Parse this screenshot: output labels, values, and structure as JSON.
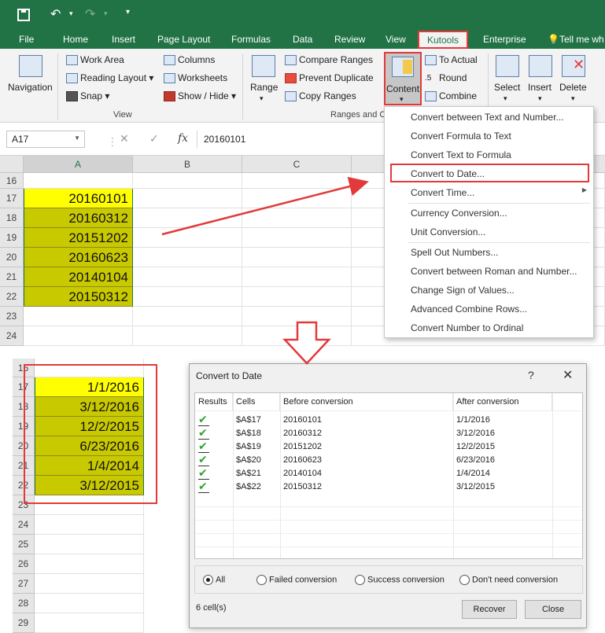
{
  "quick_access": {
    "save_icon": "save-icon",
    "undo_icon": "undo-icon",
    "redo_icon": "redo-icon"
  },
  "tabs": [
    "File",
    "Home",
    "Insert",
    "Page Layout",
    "Formulas",
    "Data",
    "Review",
    "View",
    "Kutools",
    "Enterprise",
    "Tell me wh"
  ],
  "ribbon": {
    "navigation": "Navigation",
    "view_group": {
      "work_area": "Work Area",
      "reading_layout": "Reading Layout",
      "snap": "Snap",
      "columns": "Columns",
      "worksheets": "Worksheets",
      "show_hide": "Show / Hide",
      "label": "View"
    },
    "range_group": {
      "range": "Range",
      "compare_ranges": "Compare Ranges",
      "prevent_duplicate": "Prevent Duplicate",
      "copy_ranges": "Copy Ranges",
      "label": "Ranges and C"
    },
    "content": "Content",
    "to_actual": "To Actual",
    "round": "Round",
    "combine": "Combine",
    "select": "Select",
    "insert": "Insert",
    "delete": "Delete"
  },
  "formula_bar": {
    "name_box": "A17",
    "formula": "20160101",
    "cancel": "✕",
    "enter": "✓",
    "fx": "fx"
  },
  "grid_top": {
    "columns": [
      "A",
      "B",
      "C"
    ],
    "rows": [
      "16",
      "17",
      "18",
      "19",
      "20",
      "21",
      "22",
      "23",
      "24"
    ],
    "values": [
      "20160101",
      "20160312",
      "20151202",
      "20160623",
      "20140104",
      "20150312"
    ]
  },
  "menu": {
    "items": [
      "Convert between Text and Number...",
      "Convert Formula to Text",
      "Convert Text to Formula",
      "Convert to Date...",
      "Convert Time...",
      "Currency Conversion...",
      "Unit Conversion...",
      "Spell Out Numbers...",
      "Convert between Roman and Number...",
      "Change Sign of Values...",
      "Advanced Combine Rows...",
      "Convert Number to Ordinal"
    ]
  },
  "grid_bottom": {
    "rows": [
      "16",
      "17",
      "18",
      "19",
      "20",
      "21",
      "22",
      "23",
      "24",
      "25",
      "26",
      "27",
      "28",
      "29"
    ],
    "values": [
      "1/1/2016",
      "3/12/2016",
      "12/2/2015",
      "6/23/2016",
      "1/4/2014",
      "3/12/2015"
    ]
  },
  "dialog": {
    "title": "Convert to Date",
    "help": "?",
    "close": "✕",
    "headers": [
      "Results",
      "Cells",
      "Before conversion",
      "After conversion"
    ],
    "rows": [
      {
        "cell": "$A$17",
        "before": "20160101",
        "after": "1/1/2016"
      },
      {
        "cell": "$A$18",
        "before": "20160312",
        "after": "3/12/2016"
      },
      {
        "cell": "$A$19",
        "before": "20151202",
        "after": "12/2/2015"
      },
      {
        "cell": "$A$20",
        "before": "20160623",
        "after": "6/23/2016"
      },
      {
        "cell": "$A$21",
        "before": "20140104",
        "after": "1/4/2014"
      },
      {
        "cell": "$A$22",
        "before": "20150312",
        "after": "3/12/2015"
      }
    ],
    "filters": [
      "All",
      "Failed conversion",
      "Success conversion",
      "Don't need conversion"
    ],
    "selected_filter": "All",
    "count": "6 cell(s)",
    "recover": "Recover",
    "close_btn": "Close"
  },
  "colors": {
    "excel_green": "#217346",
    "highlight_red": "#e23a3a",
    "cell_yellow": "#ffff00",
    "cell_olive": "#c9c900",
    "check_green": "#2fa42f"
  }
}
